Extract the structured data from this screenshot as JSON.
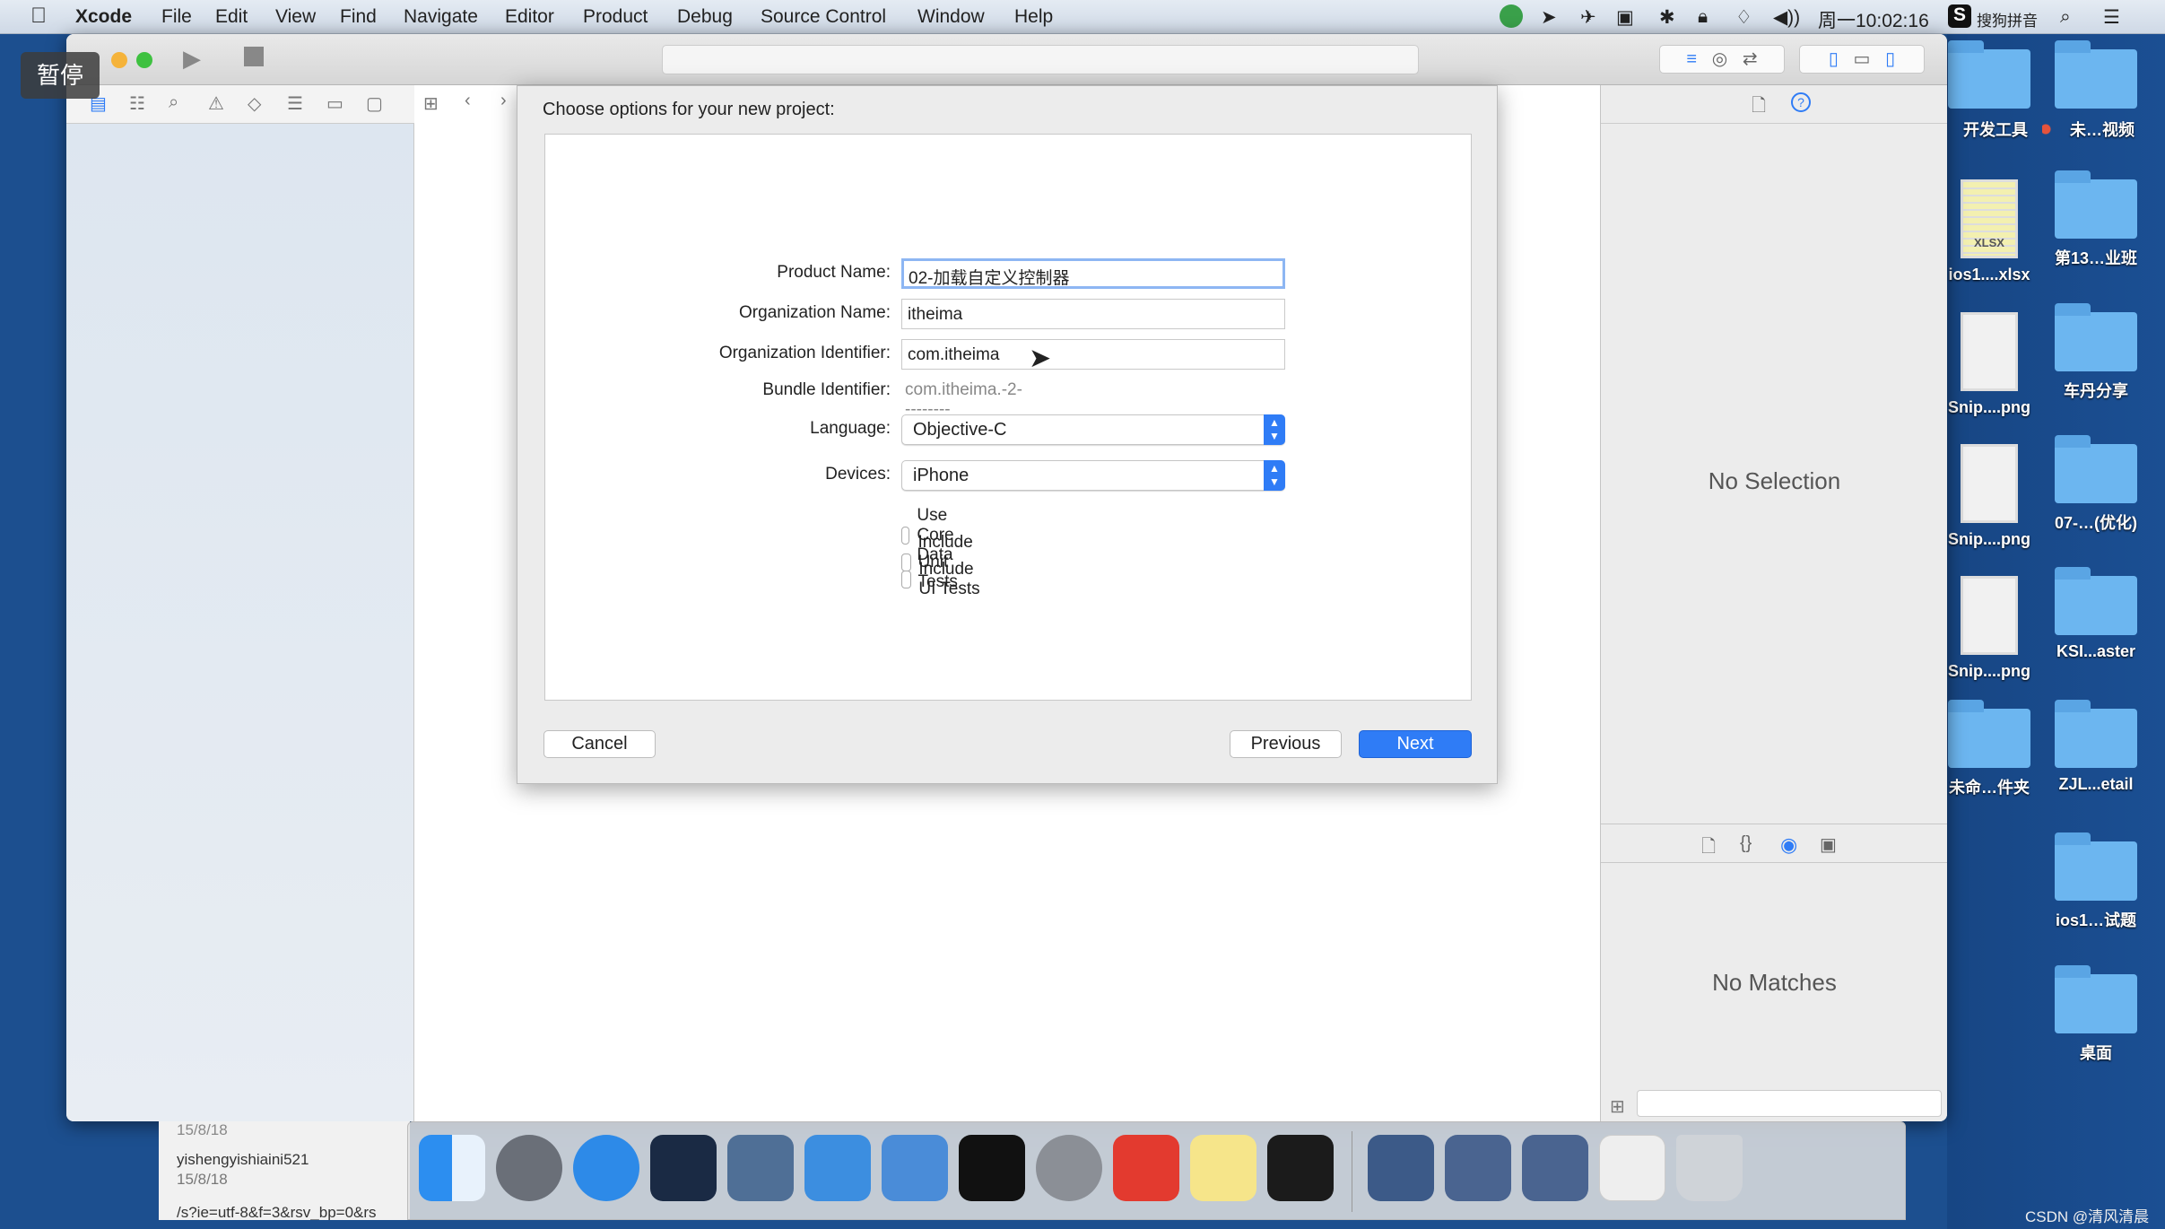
{
  "menubar": {
    "items": [
      "Xcode",
      "File",
      "Edit",
      "View",
      "Find",
      "Navigate",
      "Editor",
      "Product",
      "Debug",
      "Source Control",
      "Window",
      "Help"
    ],
    "clock": "周一10:02:16",
    "input_method": "搜狗拼音"
  },
  "overlay_badge": "暂停",
  "dialog": {
    "title": "Choose options for your new project:",
    "product_name_label": "Product Name:",
    "product_name": "02-加载自定义控制器",
    "org_name_label": "Organization Name:",
    "org_name": "itheima",
    "org_id_label": "Organization Identifier:",
    "org_id": "com.itheima",
    "bundle_id_label": "Bundle Identifier:",
    "bundle_id": "com.itheima.-2---------",
    "language_label": "Language:",
    "language": "Objective-C",
    "devices_label": "Devices:",
    "devices": "iPhone",
    "checkboxes": [
      {
        "label": "Use Core Data",
        "checked": false
      },
      {
        "label": "Include Unit Tests",
        "checked": false
      },
      {
        "label": "Include UI Tests",
        "checked": false
      }
    ],
    "cancel": "Cancel",
    "previous": "Previous",
    "next": "Next"
  },
  "inspector": {
    "no_selection": "No Selection",
    "no_matches": "No Matches"
  },
  "desktop": {
    "left": [
      "开发工具",
      "ios1....xlsx",
      "Snip....png",
      "Snip....png",
      "Snip....png",
      "未命…件夹"
    ],
    "right": [
      "未…视频",
      "第13…业班",
      "车丹分享",
      "07-…(优化)",
      "KSI...aster",
      "ZJL...etail",
      "ios1…试题",
      "桌面"
    ],
    "xlsx_badge": "XLSX"
  },
  "background_list": {
    "item_date_top": "15/8/18",
    "item_name": "yishengyishiaini521",
    "item_date": "15/8/18",
    "item_url": "/s?ie=utf-8&f=3&rsv_bp=0&rs"
  },
  "watermark": "CSDN @清风清晨",
  "colors": {
    "accent": "#2f7cf6",
    "desktop": "#1c4f8f"
  }
}
